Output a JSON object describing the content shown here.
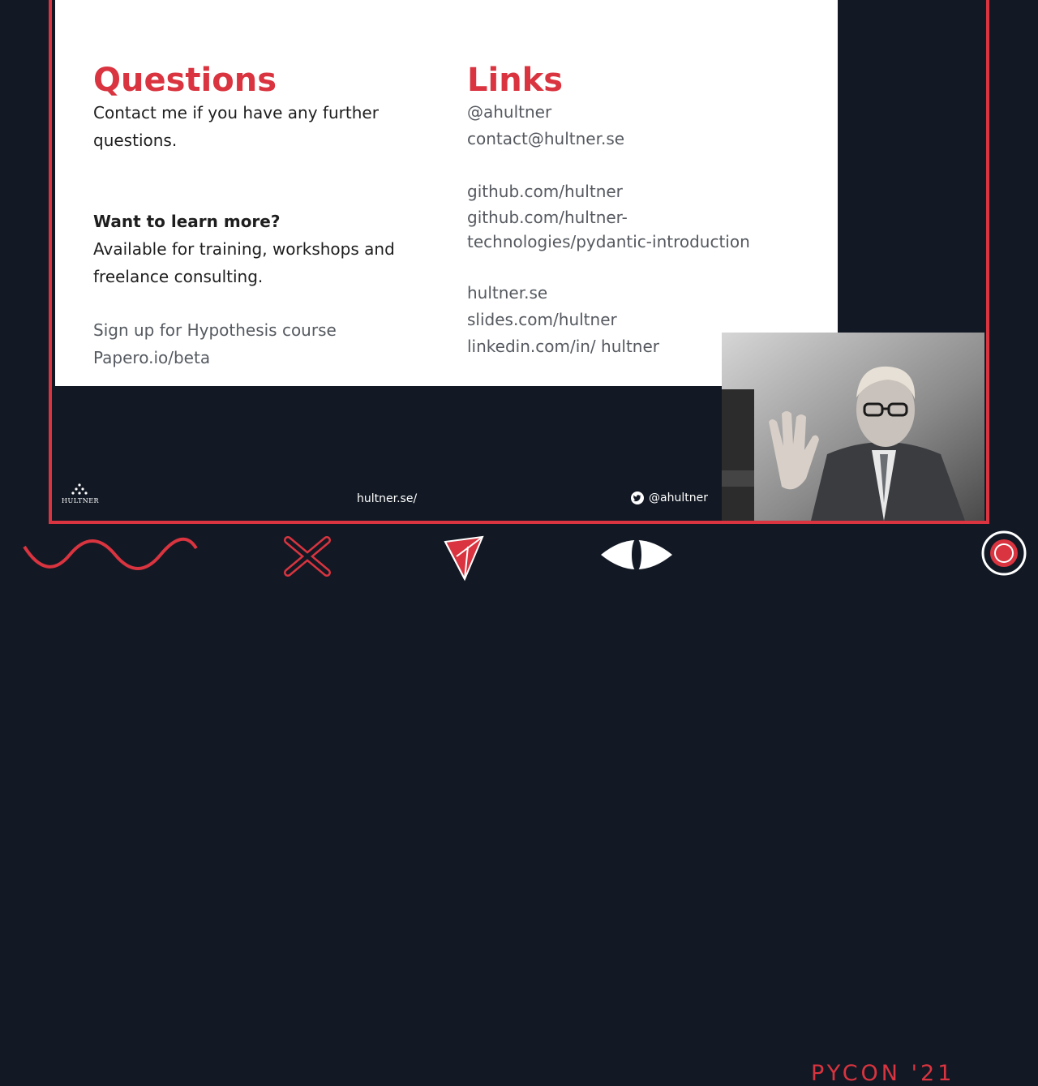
{
  "slide": {
    "left": {
      "title": "Questions",
      "intro_line1": "Contact me if you have any further",
      "intro_line2": "questions.",
      "learn_heading": "Want to learn more?",
      "learn_line1": "Available for training, workshops and",
      "learn_line2": "freelance consulting.",
      "signup_line": "Sign up for Hypothesis course",
      "signup_link": "Papero.io/beta"
    },
    "right": {
      "title": "Links",
      "links_group1": [
        "@ahultner",
        "contact@hultner.se"
      ],
      "links_group2": [
        "github.com/hultner"
      ],
      "repo_line1": "github.com/hultner-",
      "repo_line2": "technologies/pydantic-introduction",
      "links_group3": [
        "hultner.se",
        "slides.com/hultner",
        "linkedin.com/in/ hultner"
      ]
    }
  },
  "footer": {
    "website": "hultner.se/",
    "twitter": "@ahultner",
    "logo_text": "HULTNER"
  },
  "conference": {
    "name": "PYCON '21",
    "accent": "#d9343f"
  },
  "icons": [
    "twitter-icon",
    "wave-icon",
    "cross-icon",
    "triangle-icon",
    "eye-icon",
    "target-icon"
  ]
}
